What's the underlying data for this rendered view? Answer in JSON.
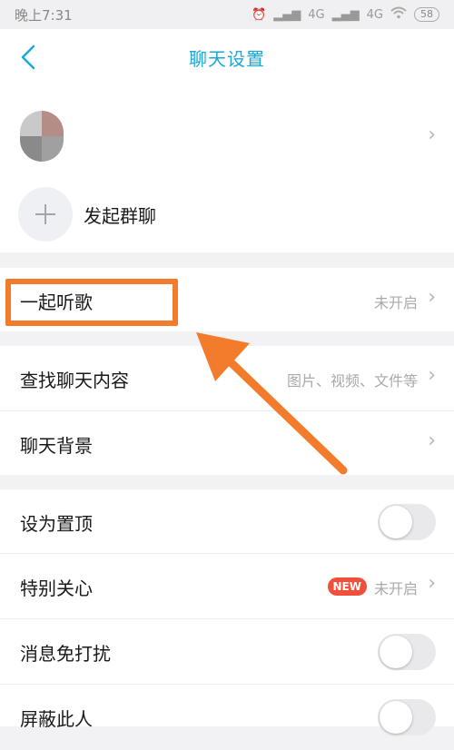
{
  "status_bar": {
    "time": "晚上7:31",
    "network1": "4G",
    "network2": "4G",
    "battery": "58",
    "icons": [
      "alarm-icon",
      "signal-icon",
      "signal-hd-icon",
      "wifi-icon",
      "battery-icon"
    ]
  },
  "header": {
    "title": "聊天设置",
    "back_icon": "chevron-left-icon"
  },
  "profile": {
    "name": "",
    "chevron_icon": "chevron-right-icon"
  },
  "start_group": {
    "label": "发起群聊",
    "icon": "plus-icon"
  },
  "sections": {
    "listen": {
      "label": "一起听歌",
      "value": "未开启"
    },
    "search": {
      "label": "查找聊天内容",
      "value": "图片、视频、文件等"
    },
    "background": {
      "label": "聊天背景"
    },
    "pin_top": {
      "label": "设为置顶",
      "enabled": false
    },
    "special_care": {
      "label": "特别关心",
      "badge": "NEW",
      "value": "未开启"
    },
    "dnd": {
      "label": "消息免打扰",
      "enabled": false
    },
    "block": {
      "label": "屏蔽此人",
      "enabled": false
    }
  },
  "colors": {
    "accent": "#1aa8d8",
    "highlight": "#f27c2b",
    "badge": "#f04f3a"
  }
}
